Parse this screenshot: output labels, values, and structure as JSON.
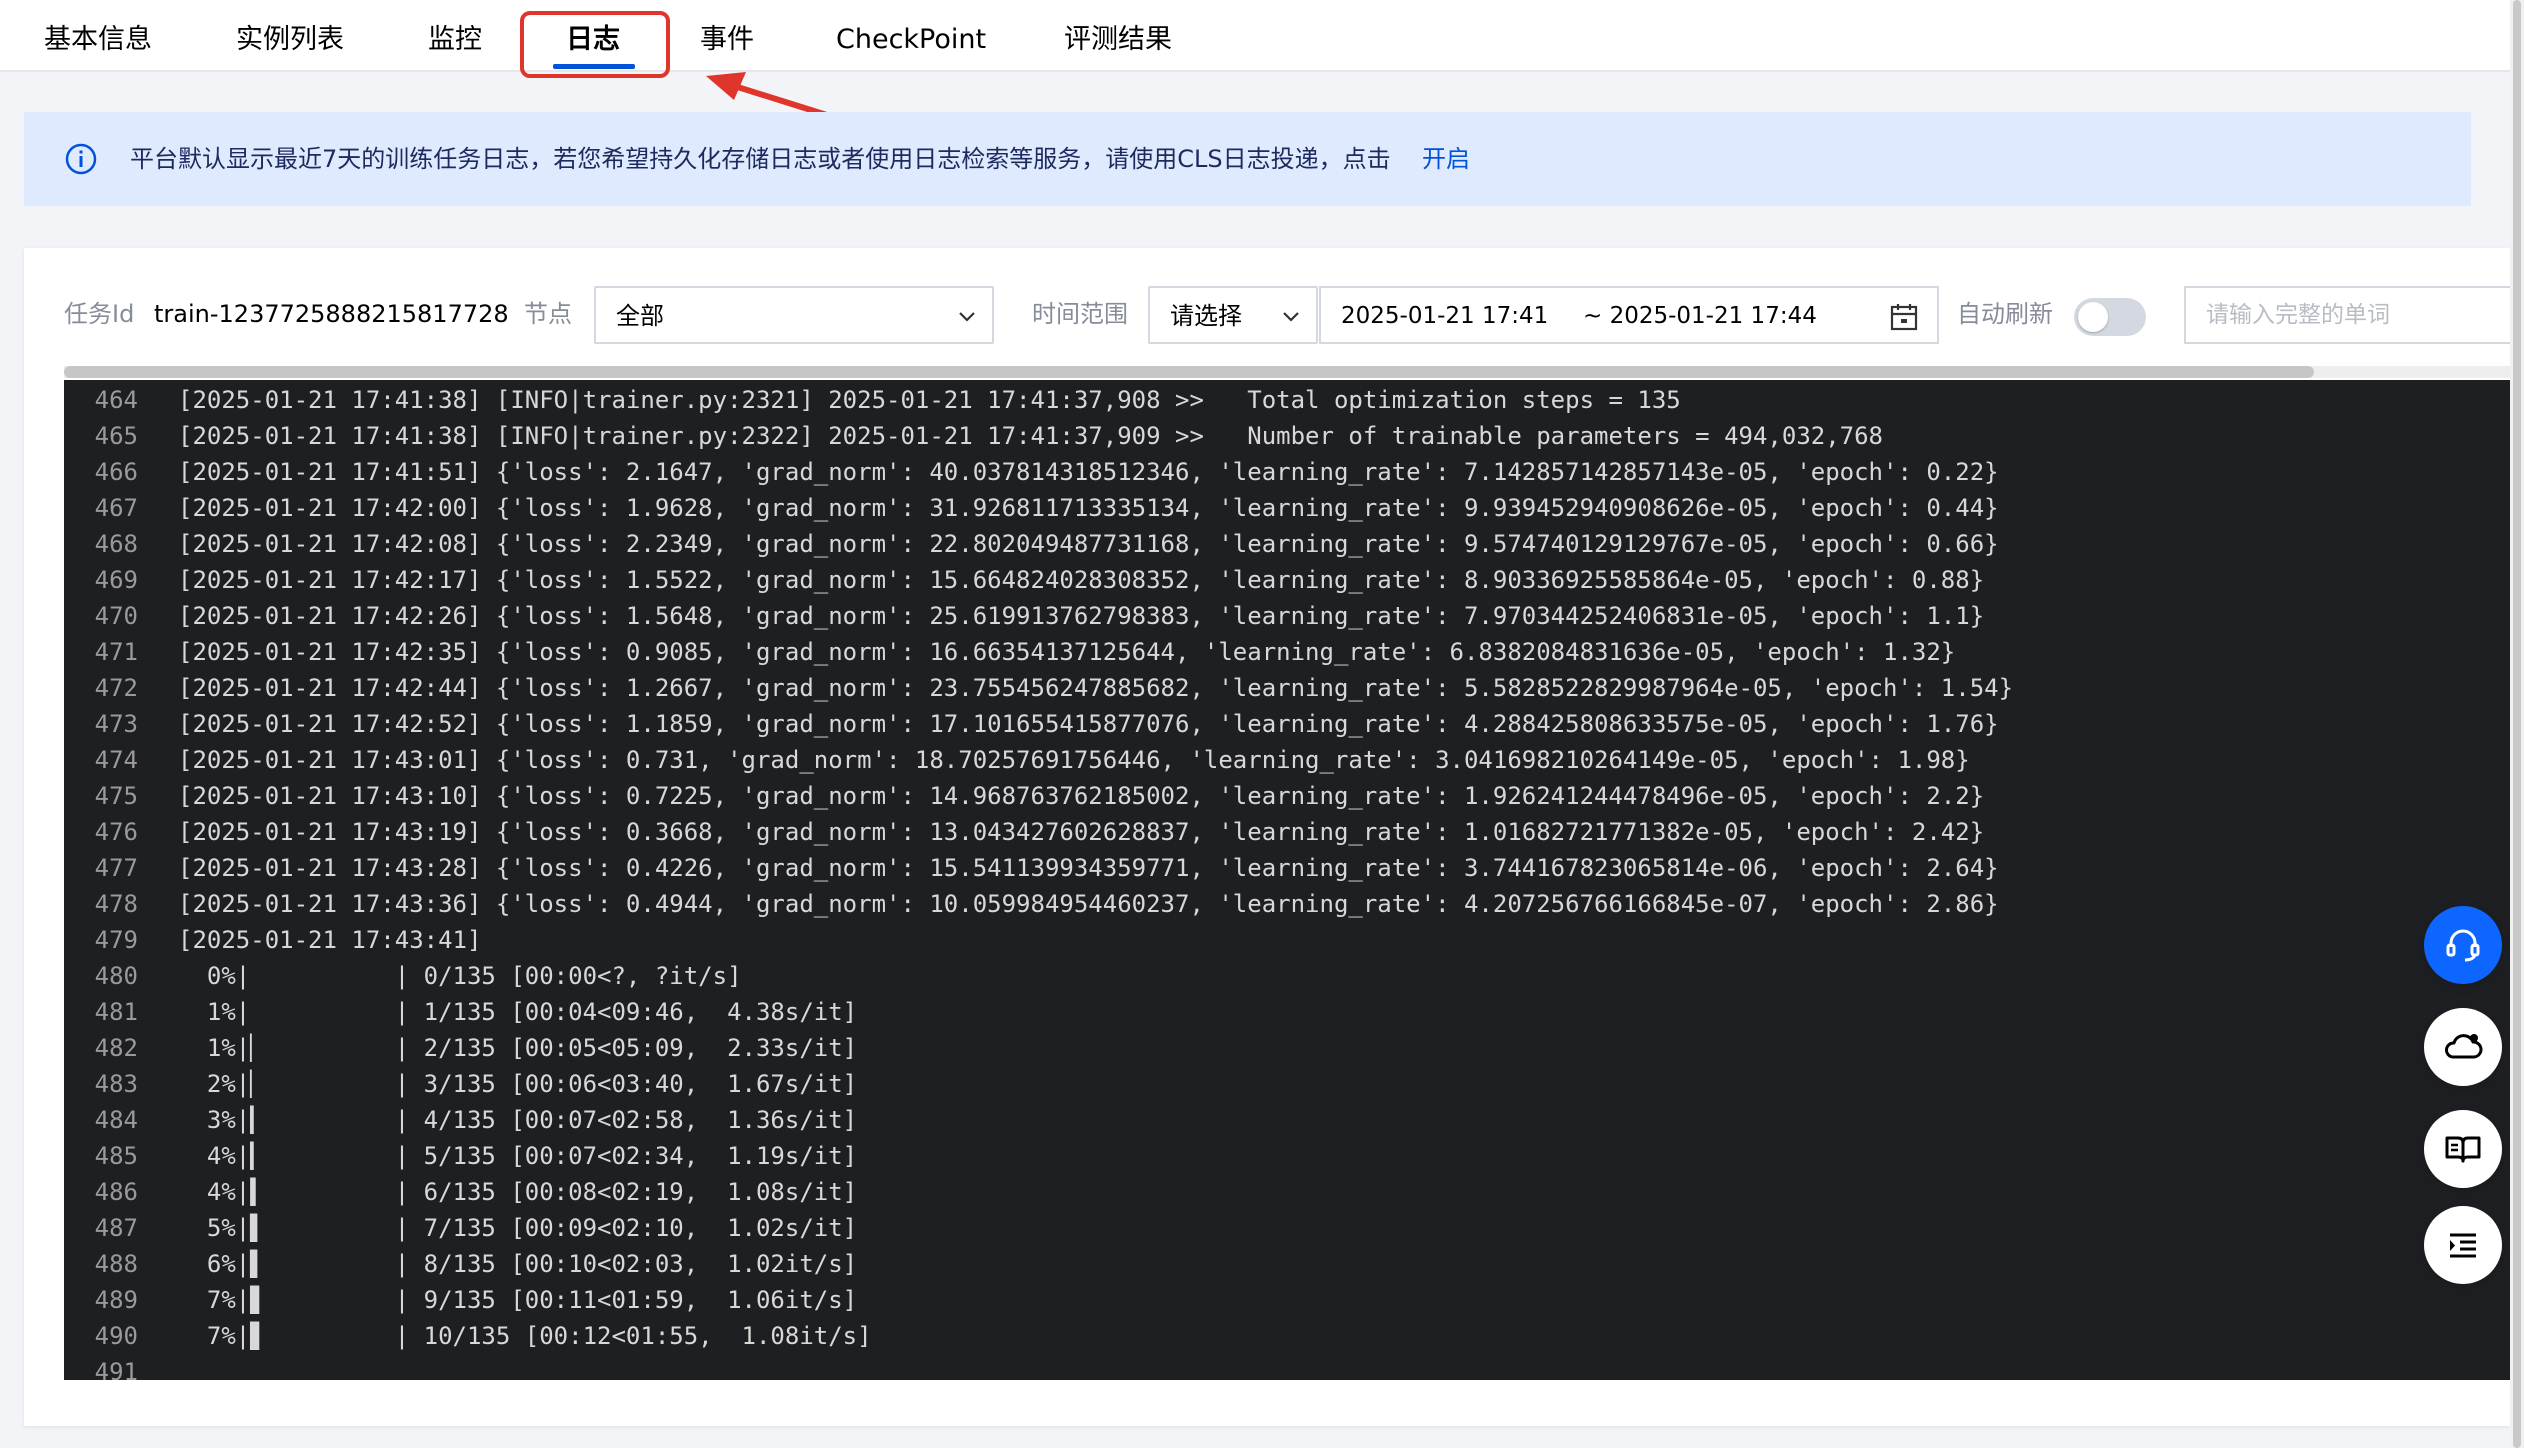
{
  "tabs": [
    {
      "label": "基本信息"
    },
    {
      "label": "实例列表"
    },
    {
      "label": "监控"
    },
    {
      "label": "日志",
      "active": true
    },
    {
      "label": "事件"
    },
    {
      "label": "CheckPoint"
    },
    {
      "label": "评测结果"
    }
  ],
  "notice": {
    "text": "平台默认显示最近7天的训练任务日志，若您希望持久化存储日志或者使用日志检索等服务，请使用CLS日志投递，点击",
    "link": "开启",
    "icon": "info-circle-icon"
  },
  "filters": {
    "task_id_label": "任务Id",
    "task_id_value": "train-1237725888215817728",
    "node_label": "节点",
    "node_value": "全部",
    "time_label": "时间范围",
    "time_select": "请选择",
    "date_start": "2025-01-21 17:41",
    "date_end": "~ 2025-01-21 17:44",
    "auto_refresh_label": "自动刷新",
    "auto_refresh_on": false,
    "search_placeholder": "请输入完整的单词"
  },
  "log_lines": [
    {
      "n": "464",
      "t": "[2025-01-21 17:41:38] [INFO|trainer.py:2321] 2025-01-21 17:41:37,908 >>   Total optimization steps = 135"
    },
    {
      "n": "465",
      "t": "[2025-01-21 17:41:38] [INFO|trainer.py:2322] 2025-01-21 17:41:37,909 >>   Number of trainable parameters = 494,032,768"
    },
    {
      "n": "466",
      "t": "[2025-01-21 17:41:51] {'loss': 2.1647, 'grad_norm': 40.037814318512346, 'learning_rate': 7.142857142857143e-05, 'epoch': 0.22}"
    },
    {
      "n": "467",
      "t": "[2025-01-21 17:42:00] {'loss': 1.9628, 'grad_norm': 31.926811713335134, 'learning_rate': 9.939452940908626e-05, 'epoch': 0.44}"
    },
    {
      "n": "468",
      "t": "[2025-01-21 17:42:08] {'loss': 2.2349, 'grad_norm': 22.802049487731168, 'learning_rate': 9.574740129129767e-05, 'epoch': 0.66}"
    },
    {
      "n": "469",
      "t": "[2025-01-21 17:42:17] {'loss': 1.5522, 'grad_norm': 15.664824028308352, 'learning_rate': 8.90336925585864e-05, 'epoch': 0.88}"
    },
    {
      "n": "470",
      "t": "[2025-01-21 17:42:26] {'loss': 1.5648, 'grad_norm': 25.619913762798383, 'learning_rate': 7.970344252406831e-05, 'epoch': 1.1}"
    },
    {
      "n": "471",
      "t": "[2025-01-21 17:42:35] {'loss': 0.9085, 'grad_norm': 16.66354137125644, 'learning_rate': 6.8382084831636e-05, 'epoch': 1.32}"
    },
    {
      "n": "472",
      "t": "[2025-01-21 17:42:44] {'loss': 1.2667, 'grad_norm': 23.755456247885682, 'learning_rate': 5.5828522829987964e-05, 'epoch': 1.54}"
    },
    {
      "n": "473",
      "t": "[2025-01-21 17:42:52] {'loss': 1.1859, 'grad_norm': 17.101655415877076, 'learning_rate': 4.288425808633575e-05, 'epoch': 1.76}"
    },
    {
      "n": "474",
      "t": "[2025-01-21 17:43:01] {'loss': 0.731, 'grad_norm': 18.70257691756446, 'learning_rate': 3.041698210264149e-05, 'epoch': 1.98}"
    },
    {
      "n": "475",
      "t": "[2025-01-21 17:43:10] {'loss': 0.7225, 'grad_norm': 14.968763762185002, 'learning_rate': 1.926241244478496e-05, 'epoch': 2.2}"
    },
    {
      "n": "476",
      "t": "[2025-01-21 17:43:19] {'loss': 0.3668, 'grad_norm': 13.043427602628837, 'learning_rate': 1.01682721771382e-05, 'epoch': 2.42}"
    },
    {
      "n": "477",
      "t": "[2025-01-21 17:43:28] {'loss': 0.4226, 'grad_norm': 15.541139934359771, 'learning_rate': 3.744167823065814e-06, 'epoch': 2.64}"
    },
    {
      "n": "478",
      "t": "[2025-01-21 17:43:36] {'loss': 0.4944, 'grad_norm': 10.059984954460237, 'learning_rate': 4.207256766166845e-07, 'epoch': 2.86}"
    },
    {
      "n": "479",
      "t": "[2025-01-21 17:43:41]"
    },
    {
      "n": "480",
      "t": "  0%|          | 0/135 [00:00<?, ?it/s]"
    },
    {
      "n": "481",
      "t": "  1%|          | 1/135 [00:04<09:46,  4.38s/it]"
    },
    {
      "n": "482",
      "t": "  1%|▏         | 2/135 [00:05<05:09,  2.33s/it]"
    },
    {
      "n": "483",
      "t": "  2%|▏         | 3/135 [00:06<03:40,  1.67s/it]"
    },
    {
      "n": "484",
      "t": "  3%|▎         | 4/135 [00:07<02:58,  1.36s/it]"
    },
    {
      "n": "485",
      "t": "  4%|▎         | 5/135 [00:07<02:34,  1.19s/it]"
    },
    {
      "n": "486",
      "t": "  4%|▍         | 6/135 [00:08<02:19,  1.08s/it]"
    },
    {
      "n": "487",
      "t": "  5%|▌         | 7/135 [00:09<02:10,  1.02s/it]"
    },
    {
      "n": "488",
      "t": "  6%|▌         | 8/135 [00:10<02:03,  1.02it/s]"
    },
    {
      "n": "489",
      "t": "  7%|▋         | 9/135 [00:11<01:59,  1.06it/s]"
    },
    {
      "n": "490",
      "t": "  7%|▋         | 10/135 [00:12<01:55,  1.08it/s]"
    },
    {
      "n": "491",
      "t": ""
    }
  ],
  "floating_buttons": [
    {
      "icon": "headset-icon"
    },
    {
      "icon": "cloud-bell-icon"
    },
    {
      "icon": "book-icon"
    },
    {
      "icon": "outline-list-icon"
    }
  ],
  "colors": {
    "brand": "#0052d9",
    "annotation": "#e0352b",
    "console_bg": "#1e1f22",
    "notice_bg": "#dfeaff"
  }
}
